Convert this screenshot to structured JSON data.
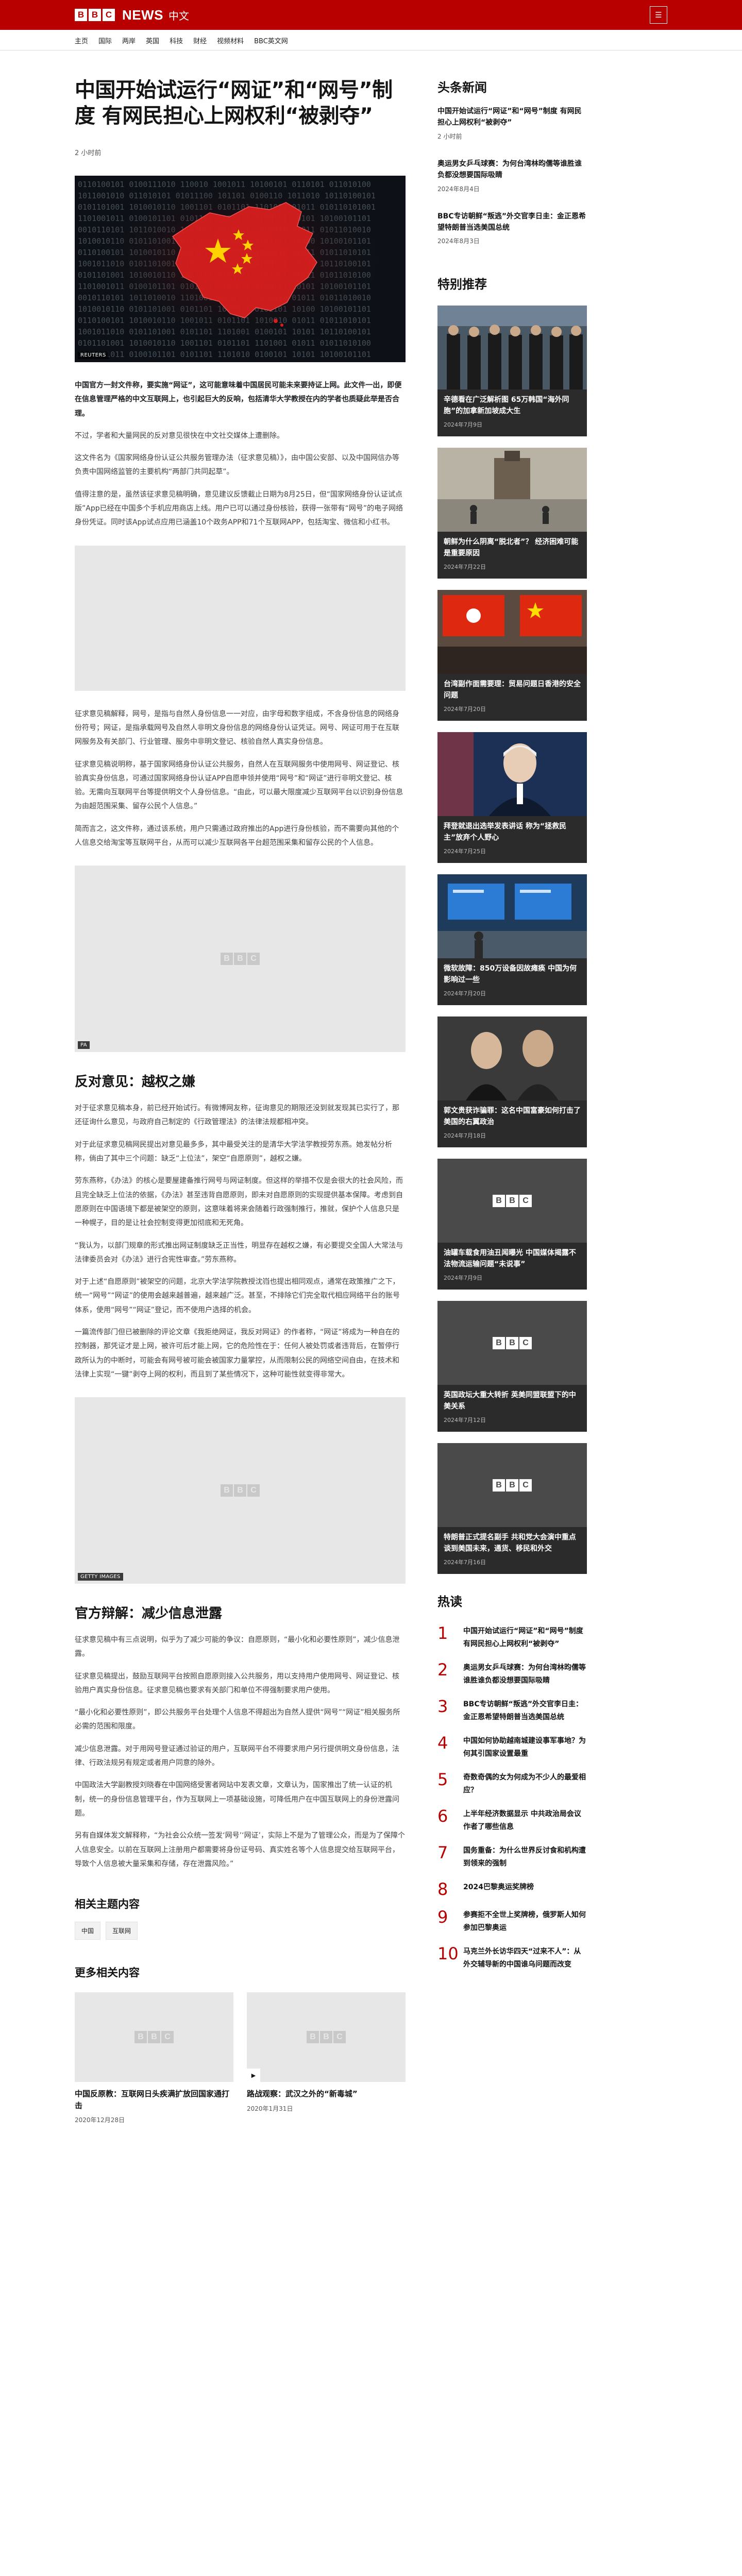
{
  "header": {
    "brand_letters": [
      "B",
      "B",
      "C"
    ],
    "brand_news": "NEWS",
    "brand_lang": "中文",
    "menu_icon": "hamburger-menu-icon"
  },
  "nav": [
    "主页",
    "国际",
    "两岸",
    "英国",
    "科技",
    "财经",
    "视频材料",
    "BBC英文网"
  ],
  "article": {
    "headline": "中国开始试运行“网证”和“网号”制度 有网民担心上网权利“被剥夺”",
    "time": "2 小时前",
    "hero_credit": "REUTERS",
    "lead": "中国官方一封文件称，要实施“网证”，这可能意味着中国居民可能未来要持证上网。此文件一出，即便在信息管理严格的中文互联网上，也引起巨大的反响，包括清华大学教授在内的学者也质疑此举是否合理。",
    "paras_1": [
      "不过，学者和大量网民的反对意见很快在中文社交媒体上遭删除。",
      "这文件名为《国家网络身份认证公共服务管理办法（征求意见稿）》，由中国公安部、以及中国网信办等负责中国网络监管的主要机构“两部门共同起草”。",
      "值得注意的是，虽然该征求意见稿明确，意见建议反馈截止日期为8月25日，但“国家网络身份认证试点版”App已经在中国多个手机应用商店上线。用户已可以通过身份核验，获得一张带有“网号”的电子网络身份凭证。同时该App试点应用已涵盖10个政务APP和71个互联网APP，包括淘宝、微信和小红书。"
    ],
    "paras_2": [
      "征求意见稿解释，网号，是指与自然人身份信息一一对应，由字母和数字组成，不含身份信息的网络身份符号；网证，是指承载网号及自然人非明文身份信息的网络身份认证凭证。网号、网证可用于在互联网服务及有关部门、行业管理、服务中非明文登记、核验自然人真实身份信息。",
      "征求意见稿说明称，基于国家网络身份认证公共服务，自然人在互联网服务中使用网号、网证登记、核验真实身份信息，可通过国家网络身份认证APP自愿申领并使用“网号”和“网证”进行非明文登记、核验。无需向互联网平台等提供明文个人身份信息。“由此，可以最大限度减少互联网平台以识别身份信息为由超范围采集、留存公民个人信息。”",
      "简而言之，这文件称，通过该系统，用户只需通过政府推出的App进行身份核验，而不需要向其他的个人信息交给淘宝等互联网平台，从而可以减少互联网各平台超范围采集和留存公民的个人信息。"
    ],
    "embed_credit_1": "PA",
    "subhead_1": "反对意见：越权之嫌",
    "paras_3": [
      "对于征求意见稿本身，前已经开始试行。有微博网友称，征询意见的期限还没到就发现其已实行了，那还征询什么意见，与政府自己制定的《行政管理法》的法律法规都相冲突。",
      "对于此征求意见稿网民提出对意见最多多，其中最受关注的是清华大学法学教授劳东燕。她发帖分析称，倘由了其中三个问题：缺乏“上位法”，架空“自愿原则”，越权之嫌。",
      "劳东燕称，《办法》的核心是要屋建备推行网号与网证制度。但这样的举措不仅是会很大的社会风险，而且完全缺乏上位法的依据，《办法》甚至违背自愿原则，即未对自愿原则的实现提供基本保障。考虑到自愿原则在中国语境下都是被架空的原则，这意味着将来会随着行政强制推行，推就，保护个人信息只是一种幌子，目的是让社会控制变得更加彻底和无死角。",
      "“我认为，以部门规章的形式推出网证制度缺乏正当性，明显存在越权之嫌，有必要提交全国人大常法与法律委员会对《办法》进行合宪性审查。”劳东燕称。",
      "对于上述“自愿原则”被架空的问题，北京大学法学院教授沈岿也提出相同观点，通常在政策推广之下，统一“网号”“网证”的使用会越来越普遍，越来越广泛。甚至，不排除它们完全取代相应网络平台的账号体系，使用“网号”“网证”登记，而不使用户选择的机会。",
      "一篇流传部门但已被删除的评论文章《我拒绝网证，我反对网证》的作者称，“网证”将成为一种自在的控制器，那凭证才是上网，被许可后才能上网，它的危险性在于：任何人被处罚或者违背后，在暂停行政所认为的中断时，可能会有网号被可能会被国家力量掌控，从而限制公民的网络空间自由，在技术和法律上实现“一键”剥夺上网的权利，而且到了某些情况下，这种可能性就变得非常大。"
    ],
    "embed_credit_2": "GETTY IMAGES",
    "subhead_2": "官方辩解：减少信息泄露",
    "paras_4": [
      "征求意见稿中有三点说明，似乎为了减少可能的争议：自愿原则，“最小化和必要性原则”，减少信息泄露。",
      "征求意见稿提出，鼓励互联网平台按照自愿原则接入公共服务，用以支持用户使用网号、网证登记、核验用户真实身份信息。征求意见稿也要求有关部门和单位不得强制要求用户使用。",
      "“最小化和必要性原则”，即公共服务平台处理个人信息不得超出为自然人提供“网号”“网证”相关服务所必需的范围和限度。",
      "减少信息泄露。对于用网号登证通过验证的用户，互联网平台不得要求用户另行提供明文身份信息，法律、行政法规另有规定或者用户同意的除外。",
      "中国政法大学副教授刘晓春在中国网络受害者网站中发表文章，文章认为，国家推出了统一认证的机制，统一的身份信息管理平台，作为互联网上一项基础设施，可降低用户在中国互联网上的身份泄露问题。",
      "另有自媒体发文解释称，“为社会公众统一签发‘网号’‘网证’，实际上不是为了管理公众，而是为了保障个人信息安全。以前在互联网上注册用户都需要将身份证号码、真实姓名等个人信息提交给互联网平台，导致个人信息被大量采集和存储，存在泄露风险。”"
    ],
    "topics_title": "相关主题内容",
    "topics": [
      "中国",
      "互联网"
    ],
    "more_title": "更多相关内容",
    "more": [
      {
        "title": "中国反原教：互联网日头疾满扩放回国家通打击",
        "date": "2020年12月28日"
      },
      {
        "title": "路战观察：武汉之外的“新毒城”",
        "date": "2020年1月31日"
      }
    ]
  },
  "sidebar": {
    "news_title": "头条新闻",
    "news": [
      {
        "title": "中国开始试运行“网证”和“网号”制度 有网民担心上网权利“被剥夺”",
        "date": "2 小时前"
      },
      {
        "title": "奥运男女乒乓球赛：为何台湾林昀儒等谁胜谁负都没想要国际吸睛",
        "date": "2024年8月4日"
      },
      {
        "title": "BBC专访朝鲜“叛逃”外交官李日圭：金正恩希望特朗普当选美国总统",
        "date": "2024年8月3日"
      }
    ],
    "rec_title": "特别推荐",
    "rec": [
      {
        "title": "辛德看在广泛解析图 65万韩国“海外同胞”的加拿新加坡成大生",
        "date": "2024年7月9日",
        "img": "group"
      },
      {
        "title": "朝鲜为什么阴离“脱北者”？ 经济困难可能是重要原因",
        "date": "2024年7月22日",
        "img": "street"
      },
      {
        "title": "台湾副作面需要理：贸易问题日香港的安全问题",
        "date": "2024年7月20日",
        "img": "flags"
      },
      {
        "title": "拜登就退出选举发表讲话 称为“拯救民主”放弃个人野心",
        "date": "2024年7月25日",
        "img": "podium"
      },
      {
        "title": "微软故障：850万设备因故瘫痪 中国为何影响过一些",
        "date": "2024年7月20日",
        "img": "screens"
      },
      {
        "title": "郭文贵获诈骗罪：这名中国富豪如何打击了美国的右翼政治",
        "date": "2024年7月18日",
        "img": "portrait"
      },
      {
        "title": "油罐车载食用油丑闻曝光 中国媒体揭露不法物流运输问题“未说事”",
        "date": "2024年7月9日",
        "img": "bbc"
      },
      {
        "title": "英国政坛大重大转折 英美同盟联盟下的中美关系",
        "date": "2024年7月12日",
        "img": "bbc"
      },
      {
        "title": "特朗普正式提名副手 共和党大会演中重点谈到美国未来，通货、移民和外交",
        "date": "2024年7月16日",
        "img": "bbc"
      }
    ],
    "pop_title": "热读",
    "popular": [
      {
        "n": "1",
        "title": "中国开始试运行“网证”和“网号”制度 有网民担心上网权利“被剥夺”"
      },
      {
        "n": "2",
        "title": "奥运男女乒乓球赛：为何台湾林昀儒等谁胜谁负都没想要国际吸睛"
      },
      {
        "n": "3",
        "title": "BBC专访朝鲜“叛逃”外交官李日圭：金正恩希望特朗普当选美国总统"
      },
      {
        "n": "4",
        "title": "中国如何协助越南城建设事军事地？为何其引国家设置最重"
      },
      {
        "n": "5",
        "title": "奇数奇偶的女为何成为不少人的最爱相应？"
      },
      {
        "n": "6",
        "title": "上半年经济数据显示 中共政治局会议作者了哪些信息"
      },
      {
        "n": "7",
        "title": "国务重备：为什么世界反讨食和机构遭到领来的强制"
      },
      {
        "n": "8",
        "title": "2024巴黎奥运奖牌榜"
      },
      {
        "n": "9",
        "title": "参赛拒不全世上奖牌榜，俄罗斯人知何参加巴黎奥运"
      },
      {
        "n": "10",
        "title": "马克兰外长访华四天“过来不人”：从外交辅导新的中国谁乌问题而改变"
      }
    ]
  }
}
